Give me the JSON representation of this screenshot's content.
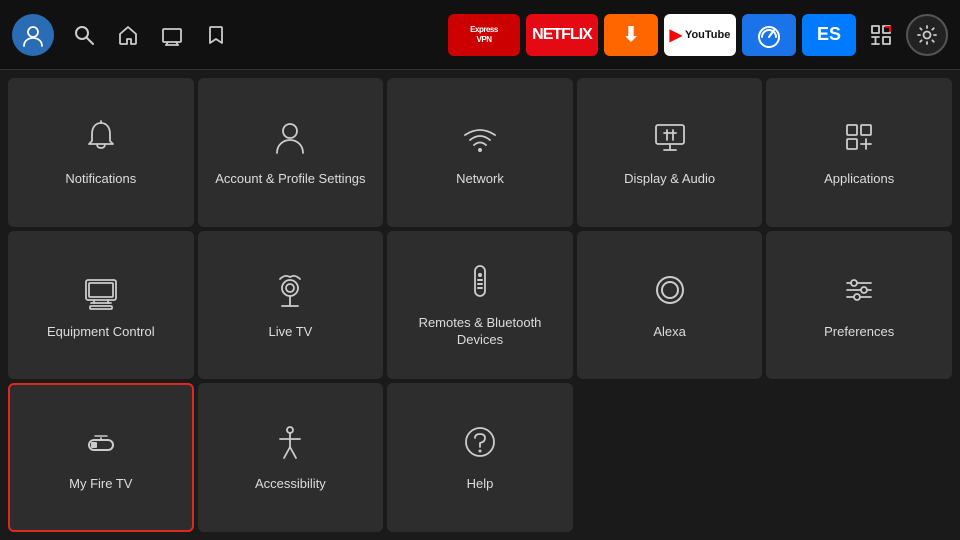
{
  "nav": {
    "apps": [
      {
        "id": "expressvpn",
        "label": "ExpressVPN",
        "bg": "#b00010",
        "textColor": "#fff"
      },
      {
        "id": "netflix",
        "label": "NETFLIX",
        "bg": "#e50914",
        "textColor": "#fff"
      },
      {
        "id": "downloader",
        "label": "Downloader",
        "bg": "#f56a00",
        "textColor": "#fff"
      },
      {
        "id": "youtube",
        "label": "YouTube",
        "bg": "#ffffff",
        "textColor": "#ff0000"
      },
      {
        "id": "speedtest",
        "label": "Internet Speed Test",
        "bg": "#1a73e8",
        "textColor": "#fff"
      },
      {
        "id": "es",
        "label": "ES",
        "bg": "#1a73e8",
        "textColor": "#fff"
      }
    ]
  },
  "settings": {
    "tiles": [
      {
        "id": "notifications",
        "label": "Notifications",
        "icon": "bell"
      },
      {
        "id": "account",
        "label": "Account & Profile Settings",
        "icon": "person"
      },
      {
        "id": "network",
        "label": "Network",
        "icon": "wifi"
      },
      {
        "id": "display-audio",
        "label": "Display & Audio",
        "icon": "display"
      },
      {
        "id": "applications",
        "label": "Applications",
        "icon": "apps"
      },
      {
        "id": "equipment-control",
        "label": "Equipment Control",
        "icon": "tv"
      },
      {
        "id": "live-tv",
        "label": "Live TV",
        "icon": "antenna"
      },
      {
        "id": "remotes-bluetooth",
        "label": "Remotes & Bluetooth Devices",
        "icon": "remote"
      },
      {
        "id": "alexa",
        "label": "Alexa",
        "icon": "alexa"
      },
      {
        "id": "preferences",
        "label": "Preferences",
        "icon": "sliders"
      },
      {
        "id": "my-fire-tv",
        "label": "My Fire TV",
        "icon": "fire-tv",
        "selected": true
      },
      {
        "id": "accessibility",
        "label": "Accessibility",
        "icon": "accessibility"
      },
      {
        "id": "help",
        "label": "Help",
        "icon": "help"
      }
    ]
  }
}
